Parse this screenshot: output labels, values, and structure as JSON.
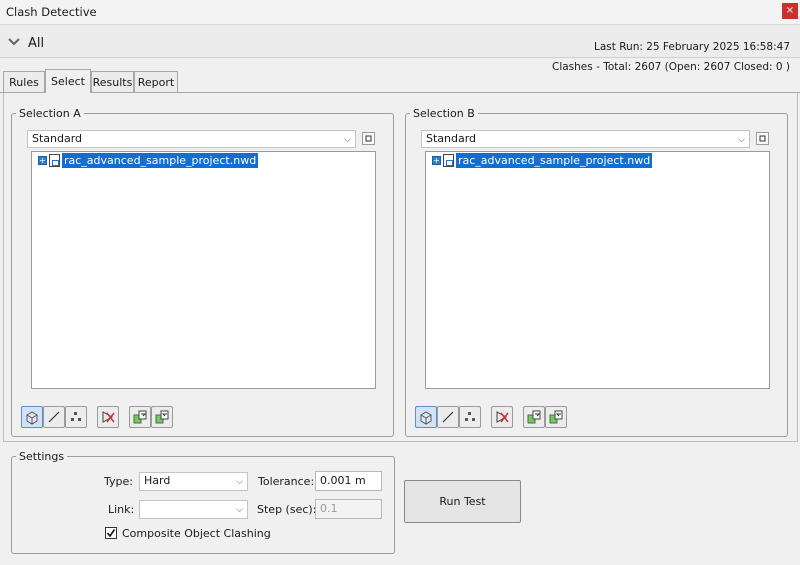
{
  "window": {
    "title": "Clash Detective",
    "close_icon": "×"
  },
  "header": {
    "group_label": "All",
    "last_run": "Last Run:  25 February 2025 16:58:47",
    "clashes_summary": "Clashes -  Total:  2607  (Open:  2607  Closed:  0 )"
  },
  "tabs": [
    {
      "label": "Rules",
      "active": false
    },
    {
      "label": "Select",
      "active": true
    },
    {
      "label": "Results",
      "active": false
    },
    {
      "label": "Report",
      "active": false
    }
  ],
  "selection_a": {
    "title": "Selection A",
    "mode": "Standard",
    "tree_item": "rac_advanced_sample_project.nwd"
  },
  "selection_b": {
    "title": "Selection B",
    "mode": "Standard",
    "tree_item": "rac_advanced_sample_project.nwd"
  },
  "settings": {
    "title": "Settings",
    "type_label": "Type:",
    "type_value": "Hard",
    "tolerance_label": "Tolerance:",
    "tolerance_value": "0.001 m",
    "link_label": "Link:",
    "link_value": "",
    "step_label": "Step (sec):",
    "step_value": "0.1",
    "composite_label": "Composite Object Clashing",
    "composite_checked": true
  },
  "run_test_label": "Run Test",
  "colors": {
    "selection_highlight": "#0f6fd4",
    "close_button": "#c8312f"
  }
}
